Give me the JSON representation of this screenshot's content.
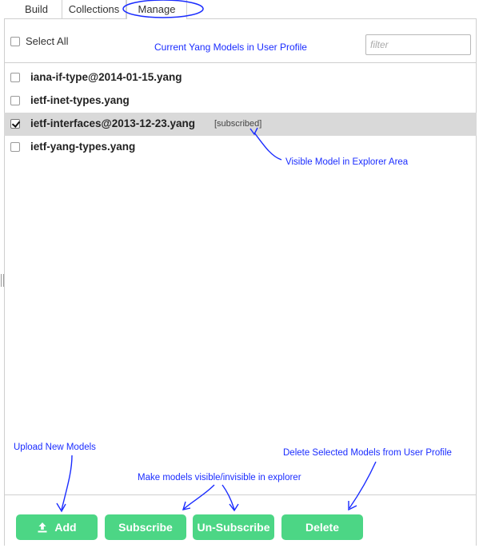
{
  "tabs": [
    {
      "label": "Build"
    },
    {
      "label": "Collections"
    },
    {
      "label": "Manage"
    }
  ],
  "header": {
    "select_all_label": "Select All",
    "title": "Current Yang Models in User Profile",
    "filter_placeholder": "filter",
    "filter_value": ""
  },
  "models": [
    {
      "name": "iana-if-type@2014-01-15.yang",
      "checked": false,
      "status": ""
    },
    {
      "name": "ietf-inet-types.yang",
      "checked": false,
      "status": ""
    },
    {
      "name": "ietf-interfaces@2013-12-23.yang",
      "checked": true,
      "status": "[subscribed]"
    },
    {
      "name": "ietf-yang-types.yang",
      "checked": false,
      "status": ""
    }
  ],
  "annotations": {
    "visible_model": "Visible Model in Explorer Area",
    "upload": "Upload New Models",
    "delete": "Delete Selected Models from User Profile",
    "visibility": "Make models visible/invisible in explorer"
  },
  "buttons": {
    "add": "Add",
    "subscribe": "Subscribe",
    "unsubscribe": "Un-Subscribe",
    "delete": "Delete"
  },
  "colors": {
    "button_green": "#4cd685",
    "annotation_blue": "#1a2cff",
    "selected_row": "#d9d9d9"
  },
  "icons": {
    "add_icon": "upload-icon",
    "checkbox": "checkbox-icon"
  }
}
